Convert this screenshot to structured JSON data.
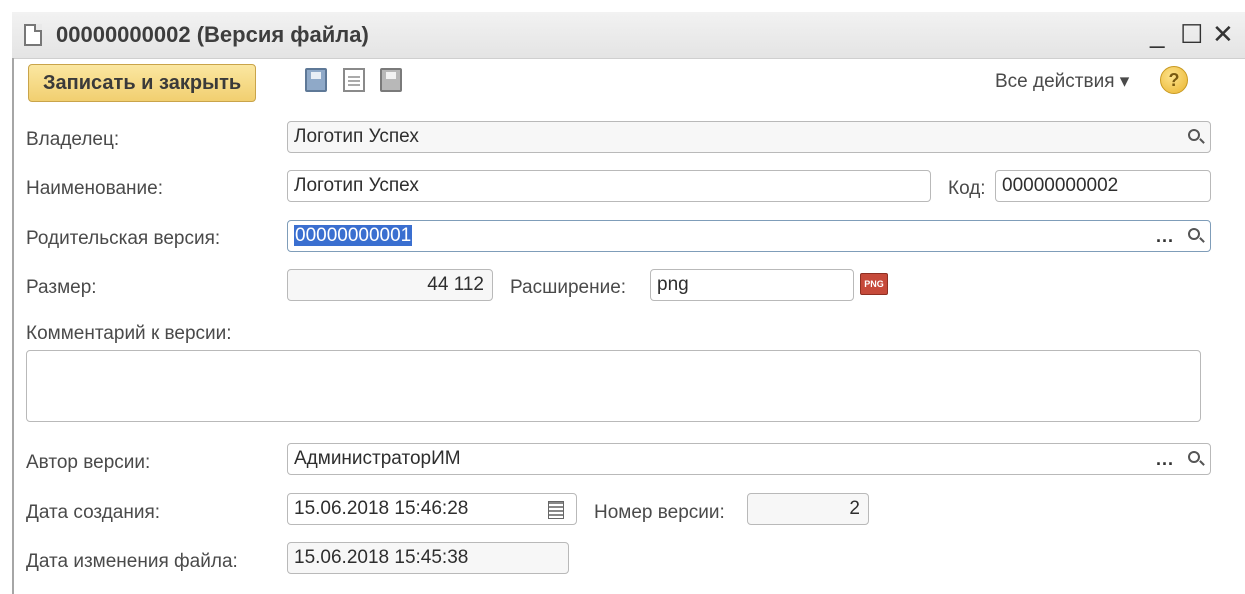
{
  "window": {
    "title": "00000000002 (Версия файла)",
    "minimize": "_",
    "maximize": "☐",
    "close": "✕"
  },
  "toolbar": {
    "save_close_label": "Записать и закрыть",
    "all_actions_label": "Все действия ▾",
    "help_label": "?",
    "icons": [
      "save-icon",
      "document-icon",
      "save-close-icon",
      "help-icon"
    ]
  },
  "form": {
    "owner": {
      "label": "Владелец:",
      "value": "Логотип Успех"
    },
    "name": {
      "label": "Наименование:",
      "value": "Логотип Успех"
    },
    "code": {
      "label": "Код:",
      "value": "00000000002"
    },
    "parent_version": {
      "label": "Родительская версия:",
      "value": "00000000001"
    },
    "size": {
      "label": "Размер:",
      "value": "44 112"
    },
    "extension": {
      "label": "Расширение:",
      "value": "png",
      "icon_text": "PNG"
    },
    "comment": {
      "label": "Комментарий к версии:",
      "value": ""
    },
    "author": {
      "label": "Автор версии:",
      "value": "АдминистраторИМ"
    },
    "created": {
      "label": "Дата создания:",
      "value": "15.06.2018 15:46:28"
    },
    "version_number": {
      "label": "Номер версии:",
      "value": "2"
    },
    "modified": {
      "label": "Дата изменения файла:",
      "value": "15.06.2018 15:45:38"
    }
  },
  "ui": {
    "choice_button": "...",
    "accent": "#3a6fd0",
    "button_gold": "#f1cf70"
  }
}
